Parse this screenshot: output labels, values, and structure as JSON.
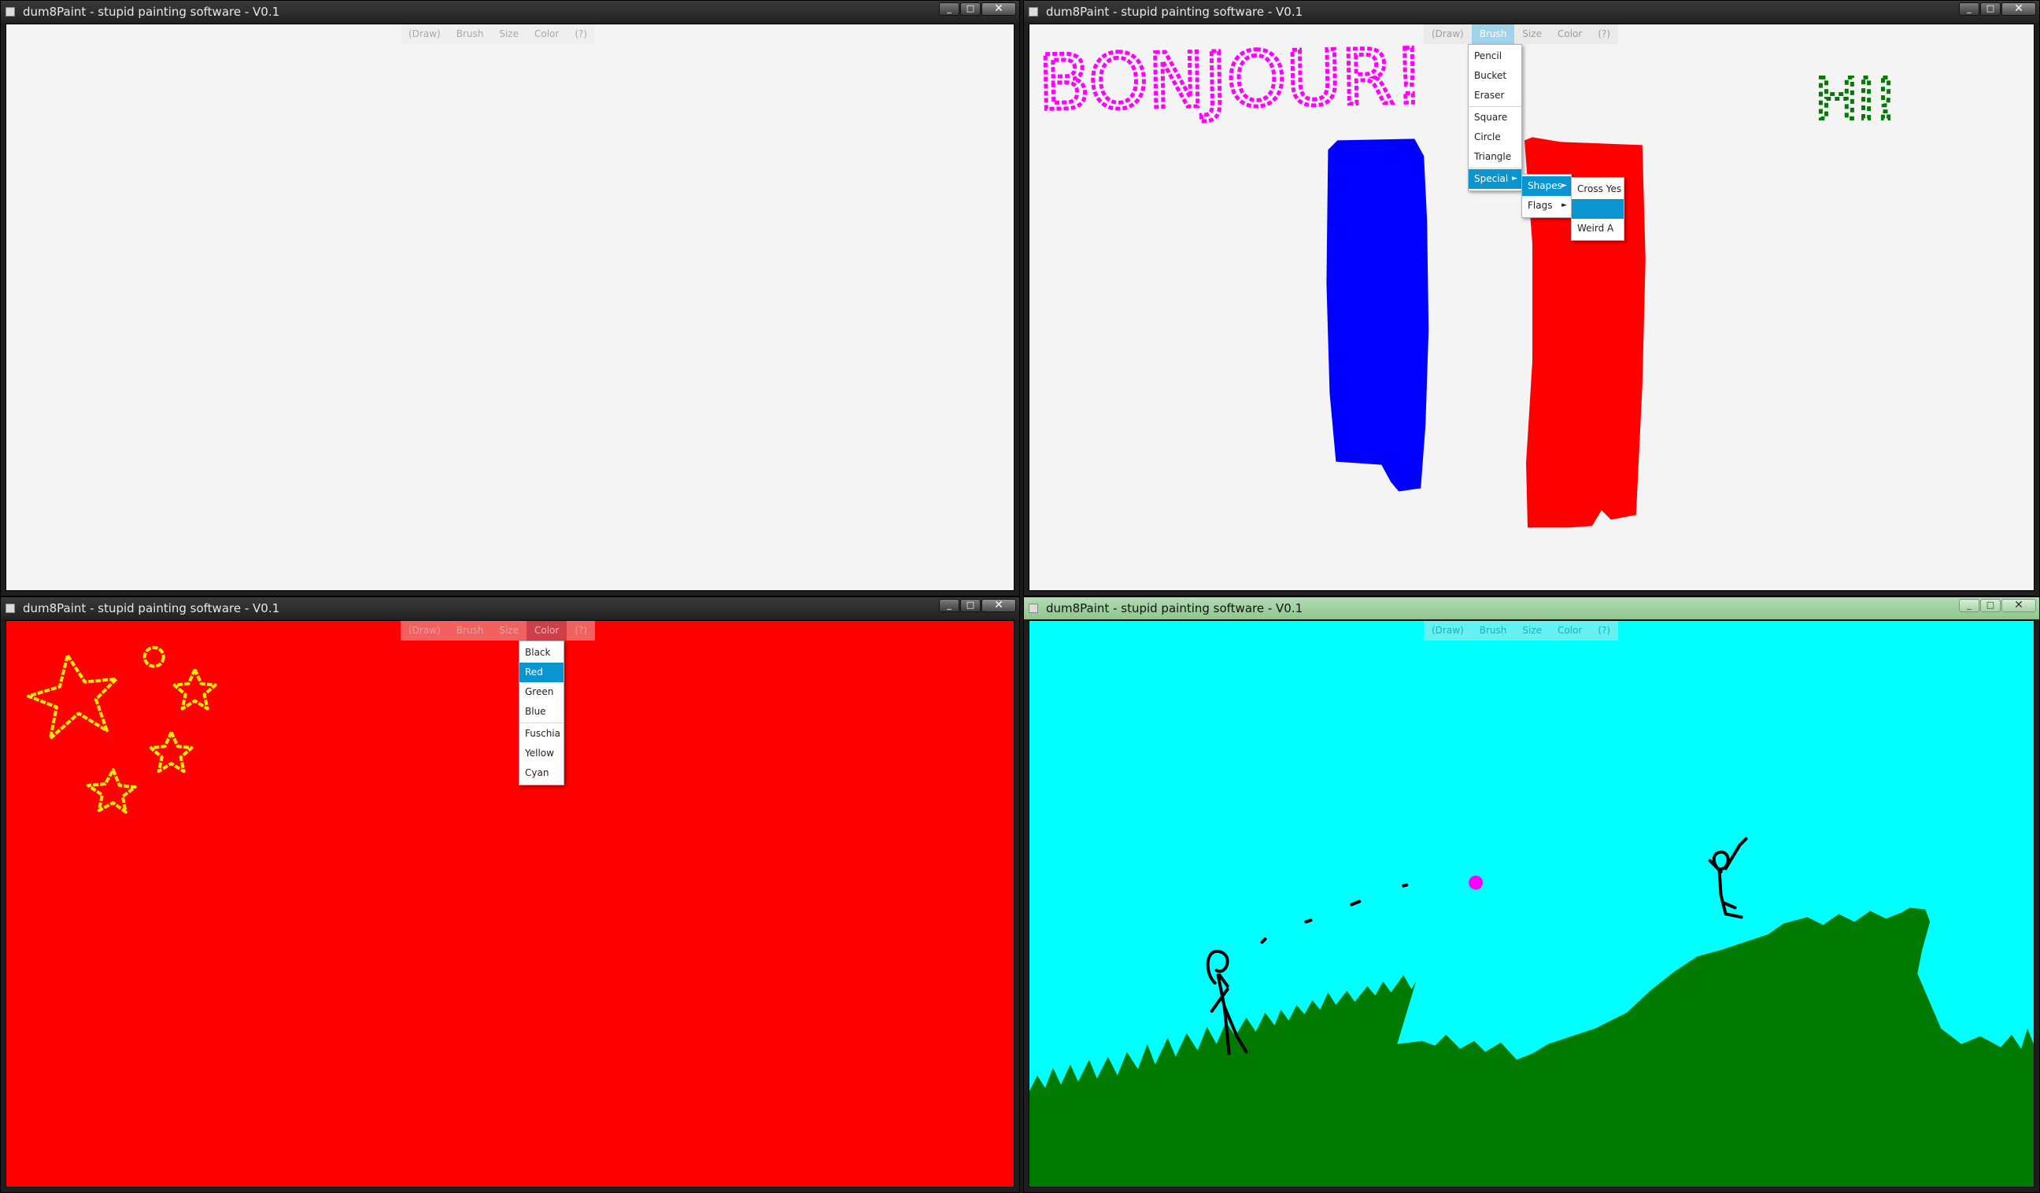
{
  "windows": [
    {
      "title": "dum8Paint - stupid painting software - V0.1",
      "menu": [
        "(Draw)",
        "Brush",
        "Size",
        "Color",
        "(?)"
      ],
      "canvas_color": "#f4f4f4"
    },
    {
      "title": "dum8Paint - stupid painting software - V0.1",
      "menu": [
        "(Draw)",
        "Brush",
        "Size",
        "Color",
        "(?)"
      ],
      "active_menu": "Brush",
      "canvas_color": "#f4f4f4",
      "brush_menu": {
        "items": [
          "Pencil",
          "Bucket",
          "Eraser",
          "Square",
          "Circle",
          "Triangle",
          "Special"
        ],
        "highlighted": "Special"
      },
      "special_menu": {
        "items": [
          "Shapes",
          "Flags"
        ],
        "highlighted": "Shapes"
      },
      "shapes_menu": {
        "items": [
          "Cross Yes",
          "",
          "Weird A"
        ],
        "highlighted_index": 1
      },
      "drawing": {
        "texts": [
          "BONJOUR!",
          "HI!"
        ],
        "colors": {
          "text1": "#ff00ff",
          "text2": "#007a00",
          "blue": "#0000ff",
          "red": "#ff0000"
        }
      }
    },
    {
      "title": "dum8Paint - stupid painting software - V0.1",
      "menu": [
        "(Draw)",
        "Brush",
        "Size",
        "Color",
        "(?)"
      ],
      "active_menu": "Color",
      "canvas_color": "#ff0000",
      "color_menu": {
        "items": [
          "Black",
          "Red",
          "Green",
          "Blue",
          "Fuschia",
          "Yellow",
          "Cyan"
        ],
        "highlighted": "Red"
      },
      "drawing": {
        "colors": {
          "stars": "#ffee00"
        }
      }
    },
    {
      "title": "dum8Paint - stupid painting software - V0.1",
      "menu": [
        "(Draw)",
        "Brush",
        "Size",
        "Color",
        "(?)"
      ],
      "canvas_color": "#00ffff",
      "drawing": {
        "colors": {
          "grass": "#007a00",
          "figures": "#000000",
          "ball": "#ff00ff"
        }
      }
    }
  ]
}
